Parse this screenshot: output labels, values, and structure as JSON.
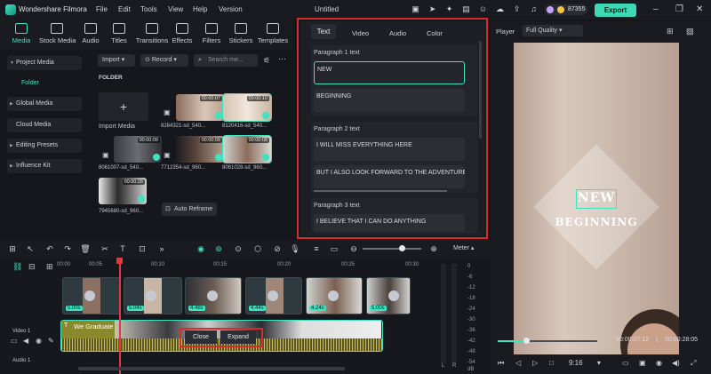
{
  "app": {
    "title": "Wondershare Filmora",
    "menu": [
      "File",
      "Edit",
      "Tools",
      "View",
      "Help",
      "Version"
    ],
    "document_title": "Untitled",
    "credits": "87355",
    "export_label": "Export"
  },
  "media_tools": [
    {
      "label": "Media",
      "icon": "media-icon",
      "active": true
    },
    {
      "label": "Stock Media",
      "icon": "stock-media-icon"
    },
    {
      "label": "Audio",
      "icon": "music-note-icon"
    },
    {
      "label": "Titles",
      "icon": "titles-icon"
    },
    {
      "label": "Transitions",
      "icon": "transitions-icon"
    },
    {
      "label": "Effects",
      "icon": "effects-icon"
    },
    {
      "label": "Filters",
      "icon": "filters-icon"
    },
    {
      "label": "Stickers",
      "icon": "stickers-icon"
    },
    {
      "label": "Templates",
      "icon": "templates-icon"
    }
  ],
  "left_nav": [
    {
      "label": "Project Media",
      "expanded": true
    },
    {
      "label": "Folder",
      "selected": true
    },
    {
      "label": "Global Media"
    },
    {
      "label": "Cloud Media"
    },
    {
      "label": "Editing Presets"
    },
    {
      "label": "Influence Kit"
    }
  ],
  "media_bin": {
    "import_label": "Import",
    "record_label": "Record",
    "search_placeholder": "Search me...",
    "folder_label": "FOLDER",
    "import_media_label": "Import Media",
    "auto_reframe_label": "Auto Reframe",
    "items": [
      {
        "name": "8284321-sd_540...",
        "duration": "00:00:07"
      },
      {
        "name": "8120416-sd_540...",
        "duration": "00:00:10"
      },
      {
        "name": "8061007-sd_540...",
        "duration": "00:00:09"
      },
      {
        "name": "7712354-sd_960...",
        "duration": "00:00:09"
      },
      {
        "name": "8061028-sd_960...",
        "duration": "00:00:08"
      },
      {
        "name": "7945680-sd_960...",
        "duration": "00:00:28"
      }
    ]
  },
  "text_panel": {
    "tabs": [
      "Text",
      "Video",
      "Audio",
      "Color"
    ],
    "active_tab": "Text",
    "paragraphs": [
      {
        "label": "Paragraph 1 text",
        "lines": [
          "NEW",
          "BEGINNING"
        ]
      },
      {
        "label": "Paragraph 2 text",
        "lines": [
          "I WILL MISS EVERYTHING HERE",
          "BUT I ALSO LOOK FORWARD TO THE ADVENTURES AH"
        ]
      },
      {
        "label": "Paragraph 3 text",
        "lines": [
          "I BELIEVE THAT I CAN DO ANYTHING"
        ]
      }
    ]
  },
  "player": {
    "label": "Player",
    "quality": "Full Quality",
    "overlay_line1": "NEW",
    "overlay_line2": "BEGINNING",
    "current_time": "00:00:07:12",
    "total_time": "00:00:28:05",
    "aspect": "9:16",
    "progress": 0.26
  },
  "timeline": {
    "ruler": [
      "00:00",
      "00:05",
      "00:10",
      "00:15",
      "00:20",
      "00:25",
      "00:30"
    ],
    "clips": [
      "5.00s",
      "5.04s",
      "4.48s",
      "4.44s",
      "4.24s",
      "5.00s"
    ],
    "video_track_label": "We Graduate",
    "video_track_name": "Video 1",
    "audio_track_name": "Audio 1",
    "context_close": "Close",
    "context_expand": "Expand",
    "meter_label": "Meter",
    "meter_ticks": [
      "0",
      "-6",
      "-12",
      "-18",
      "-24",
      "-30",
      "-36",
      "-42",
      "-48",
      "-54"
    ],
    "meter_unit": "dB",
    "meter_channels": [
      "L",
      "R"
    ]
  },
  "colors": {
    "accent": "#3fe3c0",
    "highlight": "#d92b2b",
    "background": "#16171c"
  }
}
